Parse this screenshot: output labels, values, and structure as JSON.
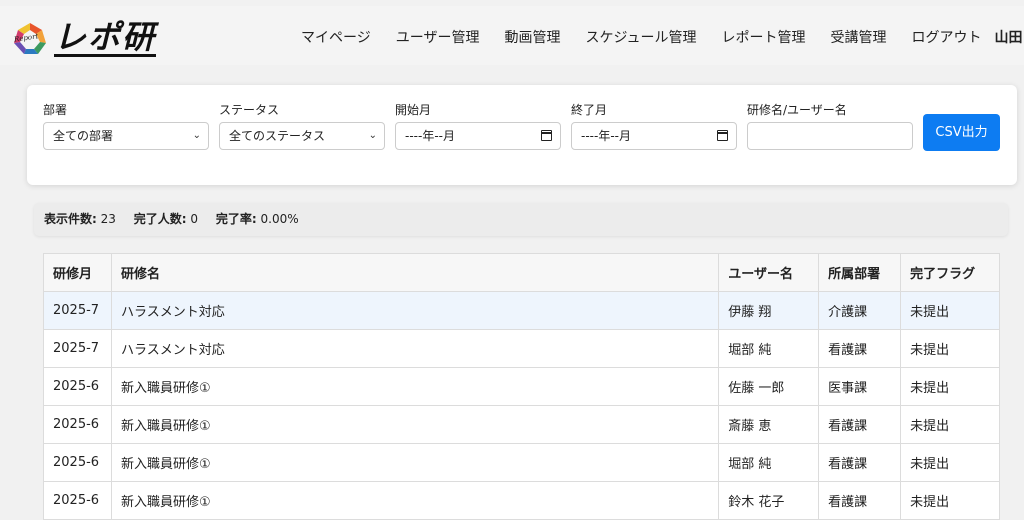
{
  "header": {
    "logo_small": "Report",
    "logo_text": "レポ研",
    "nav": [
      "マイページ",
      "ユーザー管理",
      "動画管理",
      "スケジュール管理",
      "レポート管理",
      "受講管理",
      "ログアウト"
    ],
    "user_name": "山田 太郎"
  },
  "filters": {
    "department": {
      "label": "部署",
      "value": "全ての部署"
    },
    "status": {
      "label": "ステータス",
      "value": "全てのステータス"
    },
    "start_month": {
      "label": "開始月",
      "value": "----年--月"
    },
    "end_month": {
      "label": "終了月",
      "value": "----年--月"
    },
    "search": {
      "label": "研修名/ユーザー名",
      "placeholder": ""
    },
    "csv_button": "CSV出力"
  },
  "summary": {
    "count_label": "表示件数:",
    "count_value": "23",
    "done_label": "完了人数:",
    "done_value": "0",
    "rate_label": "完了率:",
    "rate_value": "0.00%"
  },
  "table": {
    "headers": [
      "研修月",
      "研修名",
      "ユーザー名",
      "所属部署",
      "完了フラグ"
    ],
    "rows": [
      [
        "2025-7",
        "ハラスメント対応",
        "伊藤 翔",
        "介護課",
        "未提出"
      ],
      [
        "2025-7",
        "ハラスメント対応",
        "堀部 純",
        "看護課",
        "未提出"
      ],
      [
        "2025-6",
        "新入職員研修①",
        "佐藤 一郎",
        "医事課",
        "未提出"
      ],
      [
        "2025-6",
        "新入職員研修①",
        "斎藤 恵",
        "看護課",
        "未提出"
      ],
      [
        "2025-6",
        "新入職員研修①",
        "堀部 純",
        "看護課",
        "未提出"
      ],
      [
        "2025-6",
        "新入職員研修①",
        "鈴木 花子",
        "看護課",
        "未提出"
      ]
    ]
  },
  "colors": {
    "accent": "#0d7cf2"
  }
}
